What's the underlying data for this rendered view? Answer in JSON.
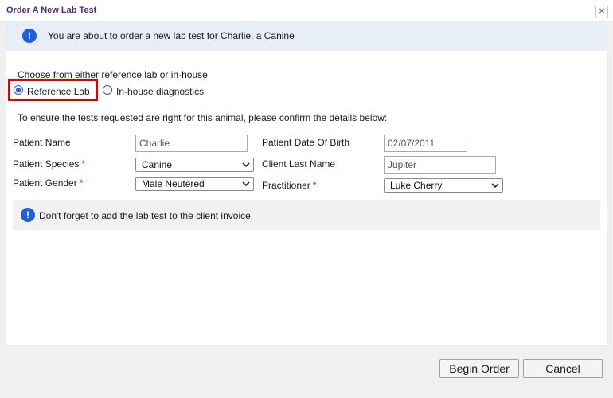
{
  "window": {
    "title": "Order A New Lab Test",
    "close_symbol": "✕"
  },
  "banner": {
    "icon": "info-icon",
    "icon_glyph": "!",
    "text": "You are about to order a new lab test for Charlie, a Canine"
  },
  "source_choice": {
    "label": "Choose from either reference lab or in-house",
    "options": [
      {
        "label": "Reference Lab",
        "selected": true
      },
      {
        "label": "In-house diagnostics",
        "selected": false
      }
    ]
  },
  "confirm_text": "To ensure the tests requested are right for this animal, please confirm the details below:",
  "fields": {
    "patient_name": {
      "label": "Patient Name",
      "value": "Charlie"
    },
    "patient_dob": {
      "label": "Patient Date Of Birth",
      "value": "02/07/2011"
    },
    "patient_species": {
      "label": "Patient Species",
      "required_mark": "*",
      "value": "Canine"
    },
    "client_last_name": {
      "label": "Client Last Name",
      "value": "Jupiter"
    },
    "patient_gender": {
      "label": "Patient Gender",
      "required_mark": "*",
      "value": "Male Neutered"
    },
    "practitioner": {
      "label": "Practitioner",
      "required_mark": "*",
      "value": "Luke Cherry"
    }
  },
  "note": {
    "icon": "info-icon",
    "icon_glyph": "!",
    "text": "Don't forget to add the lab test to the client invoice."
  },
  "footer": {
    "begin_label": "Begin Order",
    "cancel_label": "Cancel"
  },
  "colors": {
    "title": "#4b2a7b",
    "info_icon": "#1d5fdc",
    "highlight": "#e00000",
    "required": "#d40000"
  }
}
